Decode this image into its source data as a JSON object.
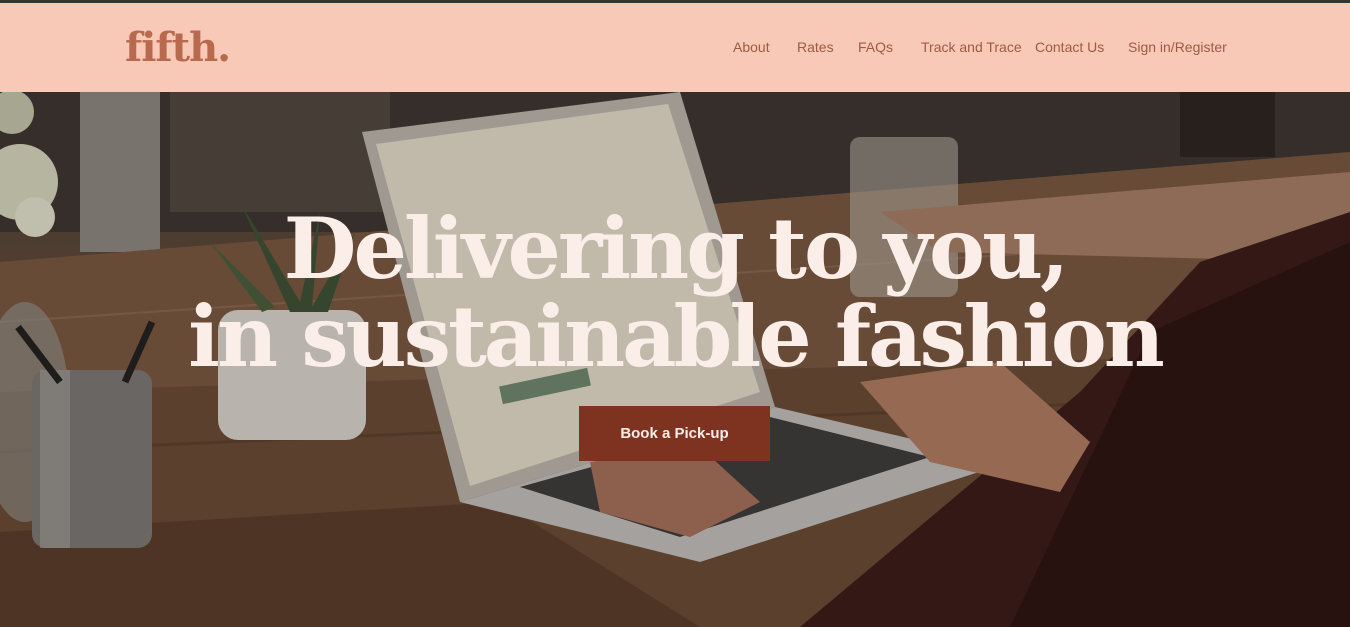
{
  "brand": {
    "logo": "fifth."
  },
  "nav": {
    "items": [
      {
        "label": "About"
      },
      {
        "label": "Rates"
      },
      {
        "label": "FAQs"
      },
      {
        "label": "Track and Trace"
      },
      {
        "label": "Contact Us"
      },
      {
        "label": "Sign in/Register"
      }
    ]
  },
  "hero": {
    "headline_line1": "Delivering to you,",
    "headline_line2": "in sustainable fashion",
    "cta_label": "Book a Pick-up"
  },
  "colors": {
    "header_bg": "#f7c9b6",
    "brand_text": "#b96a4e",
    "nav_text": "#a05a42",
    "cta_bg": "#7e3220",
    "headline_text": "#fbeee9"
  }
}
